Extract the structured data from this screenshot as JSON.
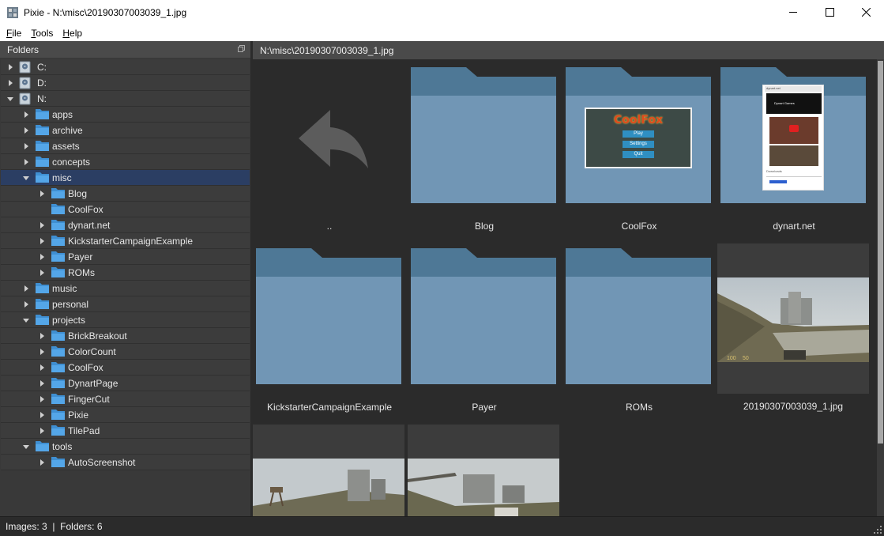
{
  "window": {
    "title": "Pixie - N:\\misc\\20190307003039_1.jpg"
  },
  "menu": [
    {
      "label": "File",
      "accel": "F",
      "rest": "ile"
    },
    {
      "label": "Tools",
      "accel": "T",
      "rest": "ools"
    },
    {
      "label": "Help",
      "accel": "H",
      "rest": "elp"
    }
  ],
  "folders_panel": {
    "title": "Folders",
    "tree": [
      {
        "label": "C:",
        "type": "drive",
        "depth": 0,
        "expanded": false
      },
      {
        "label": "D:",
        "type": "drive",
        "depth": 0,
        "expanded": false
      },
      {
        "label": "N:",
        "type": "drive",
        "depth": 0,
        "expanded": true
      },
      {
        "label": "apps",
        "type": "folder",
        "depth": 1,
        "expanded": false
      },
      {
        "label": "archive",
        "type": "folder",
        "depth": 1,
        "expanded": false
      },
      {
        "label": "assets",
        "type": "folder",
        "depth": 1,
        "expanded": false
      },
      {
        "label": "concepts",
        "type": "folder",
        "depth": 1,
        "expanded": false
      },
      {
        "label": "misc",
        "type": "folder",
        "depth": 1,
        "expanded": true,
        "selected": true
      },
      {
        "label": "Blog",
        "type": "folder",
        "depth": 2,
        "expanded": false
      },
      {
        "label": "CoolFox",
        "type": "folder",
        "depth": 2,
        "leaf": true
      },
      {
        "label": "dynart.net",
        "type": "folder",
        "depth": 2,
        "expanded": false
      },
      {
        "label": "KickstarterCampaignExample",
        "type": "folder",
        "depth": 2,
        "expanded": false
      },
      {
        "label": "Payer",
        "type": "folder",
        "depth": 2,
        "expanded": false
      },
      {
        "label": "ROMs",
        "type": "folder",
        "depth": 2,
        "expanded": false
      },
      {
        "label": "music",
        "type": "folder",
        "depth": 1,
        "expanded": false
      },
      {
        "label": "personal",
        "type": "folder",
        "depth": 1,
        "expanded": false
      },
      {
        "label": "projects",
        "type": "folder",
        "depth": 1,
        "expanded": true
      },
      {
        "label": "BrickBreakout",
        "type": "folder",
        "depth": 2,
        "expanded": false
      },
      {
        "label": "ColorCount",
        "type": "folder",
        "depth": 2,
        "expanded": false
      },
      {
        "label": "CoolFox",
        "type": "folder",
        "depth": 2,
        "expanded": false
      },
      {
        "label": "DynartPage",
        "type": "folder",
        "depth": 2,
        "expanded": false
      },
      {
        "label": "FingerCut",
        "type": "folder",
        "depth": 2,
        "expanded": false
      },
      {
        "label": "Pixie",
        "type": "folder",
        "depth": 2,
        "expanded": false
      },
      {
        "label": "TilePad",
        "type": "folder",
        "depth": 2,
        "expanded": false
      },
      {
        "label": "tools",
        "type": "folder",
        "depth": 1,
        "expanded": true
      },
      {
        "label": "AutoScreenshot",
        "type": "folder",
        "depth": 2,
        "expanded": false
      }
    ]
  },
  "gallery": {
    "path": "N:\\misc\\20190307003039_1.jpg",
    "items": [
      {
        "caption": "..",
        "kind": "up"
      },
      {
        "caption": "Blog",
        "kind": "folder"
      },
      {
        "caption": "CoolFox",
        "kind": "folder-preview-game"
      },
      {
        "caption": "dynart.net",
        "kind": "folder-preview-web"
      },
      {
        "caption": "KickstarterCampaignExample",
        "kind": "folder"
      },
      {
        "caption": "Payer",
        "kind": "folder"
      },
      {
        "caption": "ROMs",
        "kind": "folder"
      },
      {
        "caption": "20190307003039_1.jpg",
        "kind": "image",
        "selected": true
      },
      {
        "caption": "",
        "kind": "image"
      },
      {
        "caption": "",
        "kind": "image"
      }
    ],
    "coolfox_preview": {
      "logo": "CoolFox",
      "buttons": [
        "Play",
        "Settings",
        "Quit"
      ]
    },
    "dynart_preview": {
      "site_name": "dynart.net",
      "heading": "Dynart Games",
      "section": "Downloads",
      "hud_values": [
        "100",
        "50"
      ]
    }
  },
  "status": {
    "text": "Images: 3  |  Folders: 6"
  },
  "colors": {
    "folder_back": "#4e7896",
    "folder_front": "#7196b5",
    "selection": "#2b3e63",
    "panel_bg": "#393939",
    "content_bg": "#2b2b2b"
  }
}
